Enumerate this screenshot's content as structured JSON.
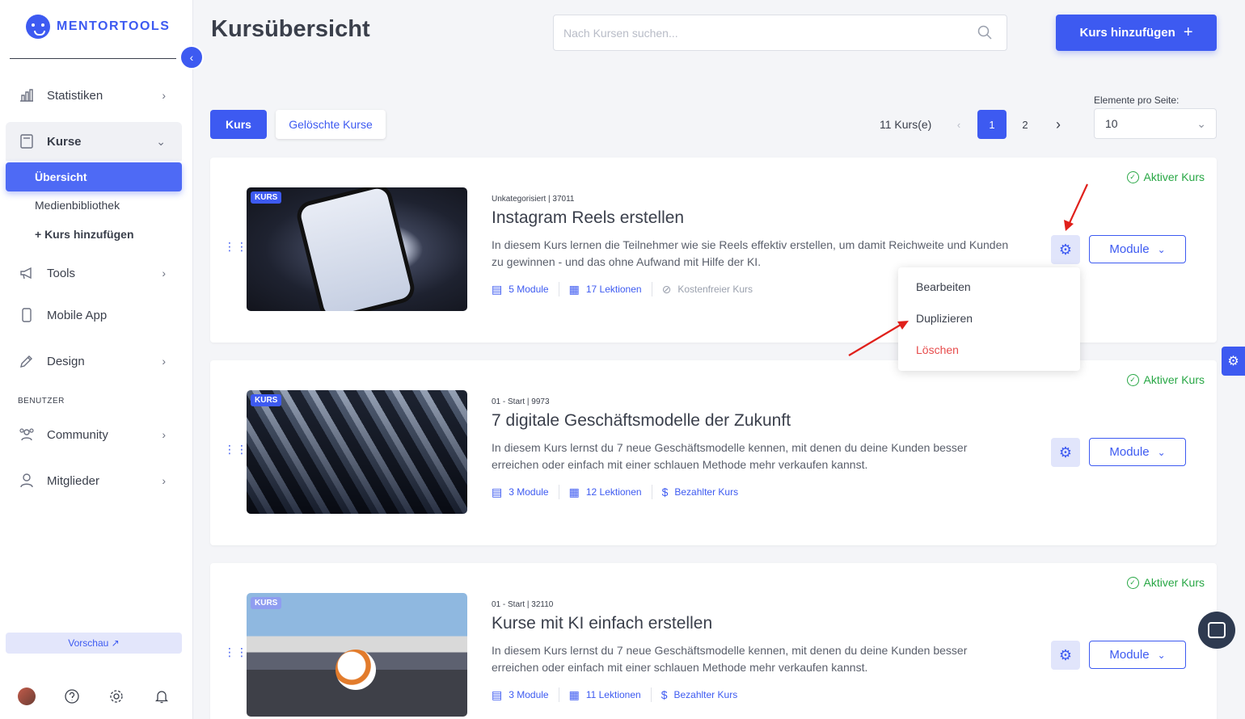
{
  "brand": {
    "name": "MENTORTOOLS"
  },
  "sidebar": {
    "items": [
      {
        "label": "Statistiken",
        "icon": "bar-chart-icon"
      },
      {
        "label": "Kurse",
        "icon": "book-icon"
      },
      {
        "label": "Tools",
        "icon": "megaphone-icon"
      },
      {
        "label": "Mobile App",
        "icon": "phone-icon"
      },
      {
        "label": "Design",
        "icon": "pen-icon"
      }
    ],
    "sub_items": [
      "Übersicht",
      "Medienbibliothek",
      "+ Kurs hinzufügen"
    ],
    "section_label": "BENUTZER",
    "user_items": [
      {
        "label": "Community",
        "icon": "community-icon"
      },
      {
        "label": "Mitglieder",
        "icon": "person-icon"
      }
    ],
    "preview_label": "Vorschau ↗"
  },
  "header": {
    "title": "Kursübersicht",
    "search_placeholder": "Nach Kursen suchen...",
    "add_label": "Kurs hinzufügen"
  },
  "filters": {
    "tab_active": "Kurs",
    "tab_deleted": "Gelöschte Kurse",
    "count": "11 Kurs(e)",
    "pages": [
      "1",
      "2"
    ],
    "per_page_label": "Elemente pro Seite:",
    "per_page_value": "10"
  },
  "courses": [
    {
      "badge": "KURS",
      "meta": "Unkategorisiert | 37011",
      "title": "Instagram Reels erstellen",
      "description": "In diesem Kurs lernen die Teilnehmer wie sie Reels effektiv erstellen, um damit Reichweite und Kunden zu gewinnen - und das ohne Aufwand mit Hilfe der KI.",
      "modules": "5 Module",
      "lessons": "17 Lektionen",
      "pricing": "Kostenfreier Kurs",
      "status": "Aktiver Kurs",
      "module_btn": "Module"
    },
    {
      "badge": "KURS",
      "meta": "01 - Start | 9973",
      "title": "7 digitale Geschäftsmodelle der Zukunft",
      "description": "In diesem Kurs lernst du 7 neue Geschäftsmodelle kennen, mit denen du deine Kunden besser erreichen oder einfach mit einer schlauen Methode mehr verkaufen kannst.",
      "modules": "3 Module",
      "lessons": "12 Lektionen",
      "pricing": "Bezahlter Kurs",
      "status": "Aktiver Kurs",
      "module_btn": "Module"
    },
    {
      "badge": "KURS",
      "meta": "01 - Start | 32110",
      "title": "Kurse mit KI einfach erstellen",
      "description": "In diesem Kurs lernst du 7 neue Geschäftsmodelle kennen, mit denen du deine Kunden besser erreichen oder einfach mit einer schlauen Methode mehr verkaufen kannst.",
      "modules": "3 Module",
      "lessons": "11 Lektionen",
      "pricing": "Bezahlter Kurs",
      "status": "Aktiver Kurs",
      "module_btn": "Module"
    }
  ],
  "dropdown": {
    "items": [
      "Bearbeiten",
      "Duplizieren",
      "Löschen"
    ]
  },
  "colors": {
    "accent": "#3d5af1",
    "success": "#28a745",
    "danger": "#e74c4c",
    "annotation": "#e0201b"
  }
}
